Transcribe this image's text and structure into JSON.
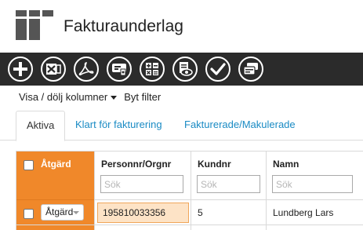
{
  "header": {
    "title": "Fakturaunderlag",
    "logo_icon": "app-grid-logo-icon"
  },
  "toolbar": {
    "buttons": [
      {
        "icon": "add-icon"
      },
      {
        "icon": "excel-icon"
      },
      {
        "icon": "pdf-icon"
      },
      {
        "icon": "invoice-print-icon"
      },
      {
        "icon": "calculator-icon"
      },
      {
        "icon": "document-preview-icon"
      },
      {
        "icon": "approve-check-icon"
      },
      {
        "icon": "invoice-cards-icon"
      }
    ]
  },
  "links": {
    "columns": "Visa / dölj kolumner",
    "filter": "Byt filter"
  },
  "tabs": [
    {
      "label": "Aktiva",
      "active": true
    },
    {
      "label": "Klart för fakturering",
      "active": false
    },
    {
      "label": "Fakturerade/Makulerade",
      "active": false
    }
  ],
  "table": {
    "action_header": "Åtgärd",
    "filter_placeholder": "Sök",
    "columns": [
      {
        "key": "personnr",
        "label": "Personnr/Orgnr"
      },
      {
        "key": "kundnr",
        "label": "Kundnr"
      },
      {
        "key": "namn",
        "label": "Namn"
      }
    ],
    "rows": [
      {
        "action_label": "Åtgärd",
        "personnr": "195810033356",
        "kundnr": "5",
        "namn": "Lundberg Lars"
      }
    ]
  },
  "colors": {
    "toolbar_bg": "#2b2b2b",
    "accent_orange": "#f0882a",
    "tab_link": "#1a8bc4",
    "highlight_bg": "#fde3c6"
  }
}
